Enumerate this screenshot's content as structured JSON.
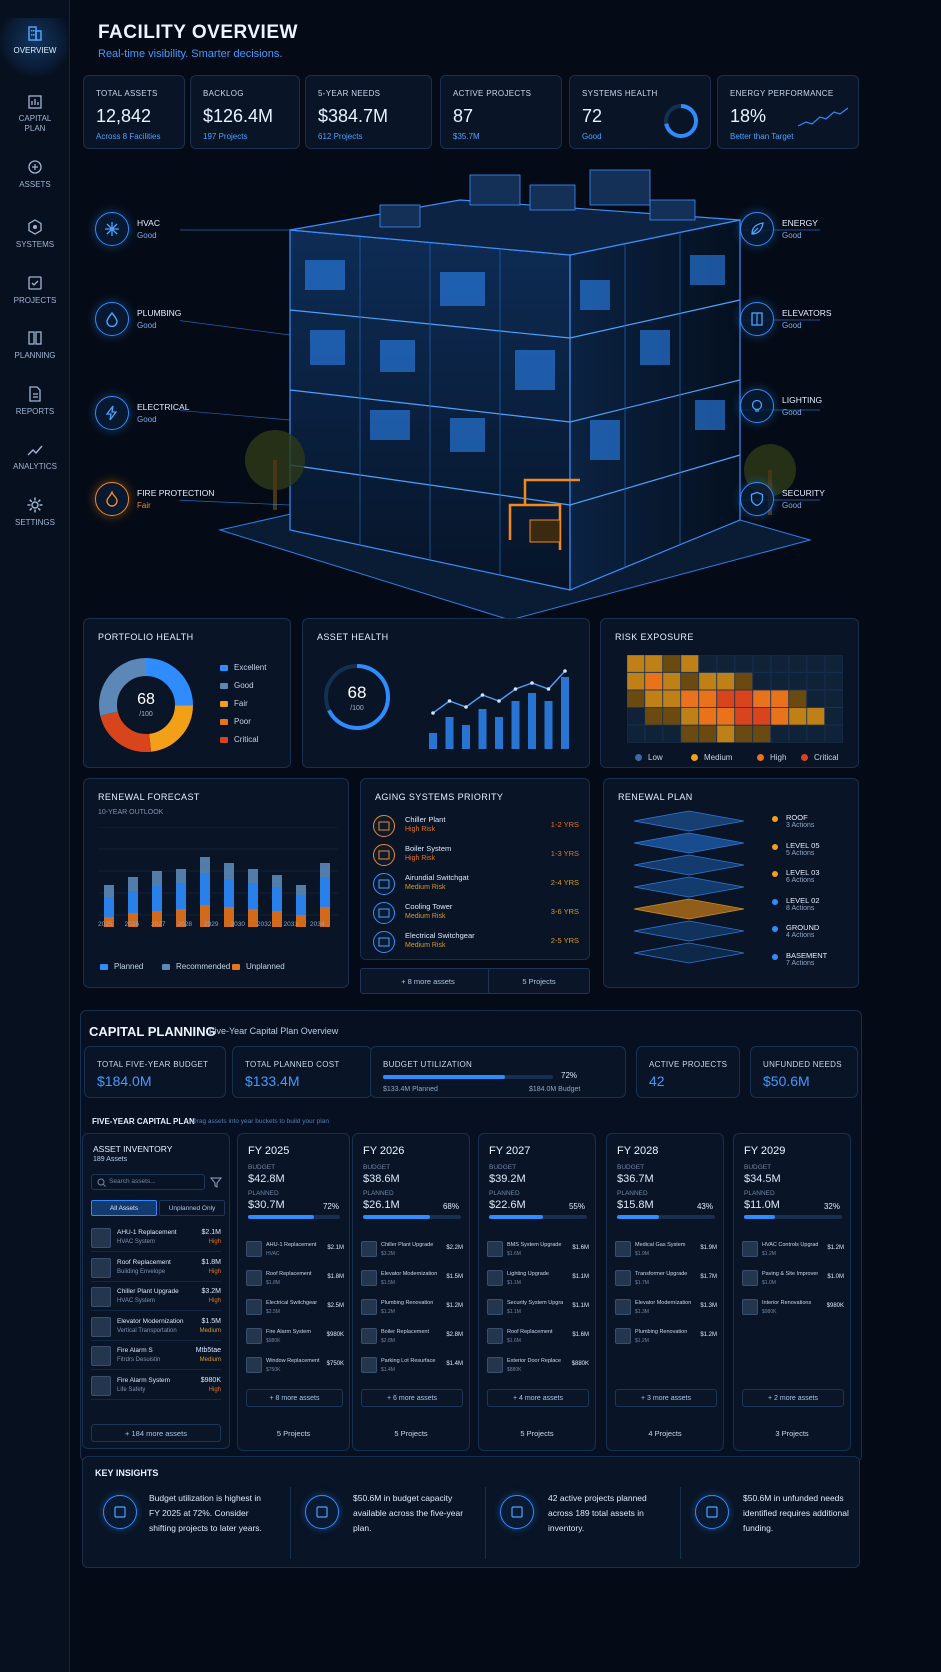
{
  "nav": [
    {
      "label": "OVERVIEW",
      "icon": "building-icon"
    },
    {
      "label": "CAPITAL PLAN",
      "icon": "capital-plan-icon"
    },
    {
      "label": "ASSETS",
      "icon": "assets-icon"
    },
    {
      "label": "SYSTEMS",
      "icon": "systems-icon"
    },
    {
      "label": "PROJECTS",
      "icon": "projects-icon"
    },
    {
      "label": "PLANNING",
      "icon": "planning-icon"
    },
    {
      "label": "REPORTS",
      "icon": "reports-icon"
    },
    {
      "label": "ANALYTICS",
      "icon": "analytics-icon"
    },
    {
      "label": "SETTINGS",
      "icon": "gear-icon"
    }
  ],
  "page": {
    "title": "FACILITY OVERVIEW",
    "subtitle": "Real-time visibility. Smarter decisions."
  },
  "kpis": [
    {
      "label": "TOTAL ASSETS",
      "value": "12,842",
      "sub": "Across 8 Facilities"
    },
    {
      "label": "BACKLOG",
      "value": "$126.4M",
      "sub": "197 Projects"
    },
    {
      "label": "5-YEAR NEEDS",
      "value": "$384.7M",
      "sub": "612 Projects"
    },
    {
      "label": "ACTIVE PROJECTS",
      "value": "87",
      "sub": "$35.7M"
    },
    {
      "label": "SYSTEMS HEALTH",
      "value": "72",
      "sub": "Good",
      "level": 0.72
    },
    {
      "label": "ENERGY PERFORMANCE",
      "value": "18%",
      "sub": "Better than Target"
    }
  ],
  "systems_left": [
    {
      "name": "HVAC",
      "status": "Good",
      "icon": "snowflake-icon"
    },
    {
      "name": "PLUMBING",
      "status": "Good",
      "icon": "water-drop-icon"
    },
    {
      "name": "ELECTRICAL",
      "status": "Good",
      "icon": "lightning-icon"
    },
    {
      "name": "FIRE PROTECTION",
      "status": "Fair",
      "icon": "flame-icon"
    }
  ],
  "systems_right": [
    {
      "name": "ENERGY",
      "status": "Good",
      "icon": "leaf-icon"
    },
    {
      "name": "ELEVATORS",
      "status": "Good",
      "icon": "elevator-icon"
    },
    {
      "name": "LIGHTING",
      "status": "Good",
      "icon": "bulb-icon"
    },
    {
      "name": "SECURITY",
      "status": "Good",
      "icon": "shield-icon"
    }
  ],
  "portfolio": {
    "title": "PORTFOLIO HEALTH",
    "score": "68",
    "scale": "/100",
    "legend": [
      "Excellent",
      "Good",
      "Fair",
      "Poor",
      "Critical"
    ],
    "colors": {
      "excellent": "#2f8cff",
      "good": "#5c88b8",
      "fair": "#f2a018",
      "poor": "#e8731a",
      "critical": "#d8441c"
    }
  },
  "asset_health": {
    "title": "ASSET HEALTH",
    "score": "68",
    "scale": "/100",
    "trend": [
      2,
      4,
      3,
      5,
      4,
      6,
      7,
      6,
      9
    ]
  },
  "risk": {
    "title": "RISK EXPOSURE",
    "legend": [
      "Low",
      "Medium",
      "High",
      "Critical"
    ]
  },
  "renewal_forecast": {
    "title": "RENEWAL FORECAST",
    "subtitle": "10-YEAR OUTLOOK",
    "years": [
      "2025",
      "2026",
      "2027",
      "2028",
      "2029",
      "2030",
      "2032",
      "2033",
      "2034"
    ],
    "legend": [
      "Planned",
      "Recommended",
      "Unplanned"
    ]
  },
  "aging": {
    "title": "AGING SYSTEMS PRIORITY",
    "items": [
      {
        "name": "Chiller Plant",
        "risk": "High Risk",
        "yrs": "1-2 YRS"
      },
      {
        "name": "Boiler System",
        "risk": "High Risk",
        "yrs": "1-3 YRS"
      },
      {
        "name": "Airundial Switchgat",
        "risk": "Medium Risk",
        "yrs": "2-4 YRS"
      },
      {
        "name": "Cooling Tower",
        "risk": "Medium Risk",
        "yrs": "3-6 YRS"
      },
      {
        "name": "Electrical Switchgear",
        "risk": "Medium Risk",
        "yrs": "2-5 YRS"
      }
    ],
    "more": "+ 8 more assets",
    "projects": "5 Projects"
  },
  "renewal_plan": {
    "title": "RENEWAL PLAN",
    "levels": [
      {
        "name": "ROOF",
        "actions": "3 Actions"
      },
      {
        "name": "LEVEL 05",
        "actions": "5 Actions"
      },
      {
        "name": "LEVEL 03",
        "actions": "6 Actions"
      },
      {
        "name": "LEVEL 02",
        "actions": "8 Actions"
      },
      {
        "name": "GROUND",
        "actions": "4 Actions"
      },
      {
        "name": "BASEMENT",
        "actions": "7 Actions"
      }
    ]
  },
  "capital": {
    "title": "CAPITAL PLANNING",
    "subtitle": "Five-Year Capital Plan Overview",
    "budget_label": "TOTAL FIVE-YEAR BUDGET",
    "budget": "$184.0M",
    "cost_label": "TOTAL PLANNED COST",
    "cost": "$133.4M",
    "util_label": "BUDGET UTILIZATION",
    "util_pct": "72%",
    "util_planned": "$133.4M Planned",
    "util_budget": "$184.0M Budget",
    "util_level": 0.72,
    "active_label": "ACTIVE PROJECTS",
    "active": "42",
    "unfunded_label": "UNFUNDED NEEDS",
    "unfunded": "$50.6M"
  },
  "plan": {
    "title": "FIVE-YEAR CAPITAL PLAN",
    "hint": "Drag assets into year buckets to build your plan"
  },
  "inventory": {
    "title": "ASSET INVENTORY",
    "count": "189 Assets",
    "search_placeholder": "Search assets...",
    "tab_all": "All Assets",
    "tab_unplanned": "Unplanned Only",
    "items": [
      {
        "name": "AHU-1 Replacement",
        "sub": "HVAC System",
        "cost": "$2.1M",
        "risk": "High"
      },
      {
        "name": "Roof Replacement",
        "sub": "Building Envelope",
        "cost": "$1.8M",
        "risk": "High"
      },
      {
        "name": "Chiller Plant Upgrade",
        "sub": "HVAC System",
        "cost": "$3.2M",
        "risk": "High"
      },
      {
        "name": "Elevator Modernization",
        "sub": "Vertical Transportation",
        "cost": "$1.5M",
        "risk": "Medium"
      },
      {
        "name": "Fire Alarm S",
        "sub": "Fitrdrs Desuistin",
        "cost": "Mtb5tae",
        "risk": "Medium"
      },
      {
        "name": "Fire Alarm System",
        "sub": "Life Safety",
        "cost": "$980K",
        "risk": "High"
      }
    ],
    "more": "+ 184 more assets"
  },
  "years": [
    {
      "fy": "FY 2025",
      "budget": "$42.8M",
      "planned": "$30.7M",
      "pct": "72%",
      "level": 0.72,
      "items": [
        {
          "n": "AHU-1 Replacement",
          "s": "HVAC",
          "c": "$2.1M"
        },
        {
          "n": "Roof Replacement",
          "s": "$1.8M",
          "c": "$1.8M"
        },
        {
          "n": "Electrical Switchgear",
          "s": "$2.5M",
          "c": "$2.5M"
        },
        {
          "n": "Fire Alarm System",
          "s": "$980K",
          "c": "$980K"
        },
        {
          "n": "Window Replacement",
          "s": "$750K",
          "c": "$750K"
        }
      ],
      "more": "+ 8 more assets",
      "projects": "5 Projects"
    },
    {
      "fy": "FY 2026",
      "budget": "$38.6M",
      "planned": "$26.1M",
      "pct": "68%",
      "level": 0.68,
      "items": [
        {
          "n": "Chiller Plant Upgrade",
          "s": "$3.2M",
          "c": "$2.2M"
        },
        {
          "n": "Elevator Modernization",
          "s": "$1.5M",
          "c": "$1.5M"
        },
        {
          "n": "Plumbing Renovation",
          "s": "$1.2M",
          "c": "$1.2M"
        },
        {
          "n": "Boiler Replacement",
          "s": "$2.8M",
          "c": "$2.8M"
        },
        {
          "n": "Parking Lot Resurface",
          "s": "$1.4M",
          "c": "$1.4M"
        }
      ],
      "more": "+ 6 more assets",
      "projects": "5 Projects"
    },
    {
      "fy": "FY 2027",
      "budget": "$39.2M",
      "planned": "$22.6M",
      "pct": "55%",
      "level": 0.55,
      "items": [
        {
          "n": "BMS System Upgrade",
          "s": "$1.6M",
          "c": "$1.6M"
        },
        {
          "n": "Lighting Upgrade",
          "s": "$1.1M",
          "c": "$1.1M"
        },
        {
          "n": "Security System Upgrade",
          "s": "$1.1M",
          "c": "$1.1M"
        },
        {
          "n": "Roof Replacement",
          "s": "$1.6M",
          "c": "$1.6M"
        },
        {
          "n": "Exterior Door Replace",
          "s": "$880K",
          "c": "$880K"
        }
      ],
      "more": "+ 4 more assets",
      "projects": "5 Projects"
    },
    {
      "fy": "FY 2028",
      "budget": "$36.7M",
      "planned": "$15.8M",
      "pct": "43%",
      "level": 0.43,
      "items": [
        {
          "n": "Medical Gas System",
          "s": "$1.9M",
          "c": "$1.9M"
        },
        {
          "n": "Transformer Upgrade",
          "s": "$1.7M",
          "c": "$1.7M"
        },
        {
          "n": "Elevator Modernization",
          "s": "$1.3M",
          "c": "$1.3M"
        },
        {
          "n": "Plumbing Renovation",
          "s": "$1.2M",
          "c": "$1.2M"
        }
      ],
      "more": "+ 3 more assets",
      "projects": "4 Projects"
    },
    {
      "fy": "FY 2029",
      "budget": "$34.5M",
      "planned": "$11.0M",
      "pct": "32%",
      "level": 0.32,
      "items": [
        {
          "n": "HVAC Controls Upgrade",
          "s": "$1.2M",
          "c": "$1.2M"
        },
        {
          "n": "Paving & Site Improvement",
          "s": "$1.0M",
          "c": "$1.0M"
        },
        {
          "n": "Interior Renovations",
          "s": "$980K",
          "c": "$980K"
        }
      ],
      "more": "+ 2 more assets",
      "projects": "3 Projects"
    }
  ],
  "insights": {
    "title": "KEY INSIGHTS",
    "items": [
      {
        "text": "Budget utilization is highest in FY 2025 at 72%. Consider shifting projects to later years.",
        "icon": "balance-icon"
      },
      {
        "text": "$50.6M in budget capacity available across the five-year plan.",
        "icon": "calendar-icon"
      },
      {
        "text": "42 active projects planned across 189 total assets in inventory.",
        "icon": "projects-icon"
      },
      {
        "text": "$50.6M in unfunded needs identified requires additional funding.",
        "icon": "alert-icon"
      }
    ]
  }
}
